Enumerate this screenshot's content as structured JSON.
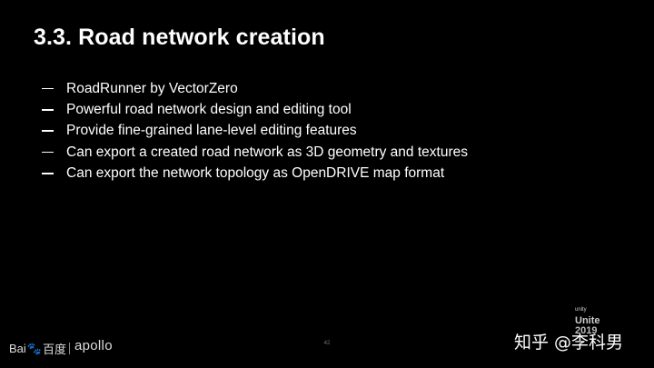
{
  "slide": {
    "title": "3.3. Road network creation",
    "bullets": [
      "RoadRunner by VectorZero",
      "Powerful road network design and editing tool",
      "Provide fine-grained lane-level editing features",
      "Can export a created road network as 3D geometry and textures",
      "Can export the network topology as OpenDRIVE map format"
    ],
    "page_number": "42"
  },
  "footer": {
    "baidu_text_left": "Bai",
    "baidu_paw": "🐾",
    "baidu_text_right": "百度",
    "apollo": "apollo",
    "unite_mark": "unity",
    "unite_word": "Unite",
    "unite_year": "2019"
  },
  "watermark": {
    "text": "知乎 @李科男"
  },
  "colors": {
    "background": "#000000",
    "text": "#ffffff"
  }
}
